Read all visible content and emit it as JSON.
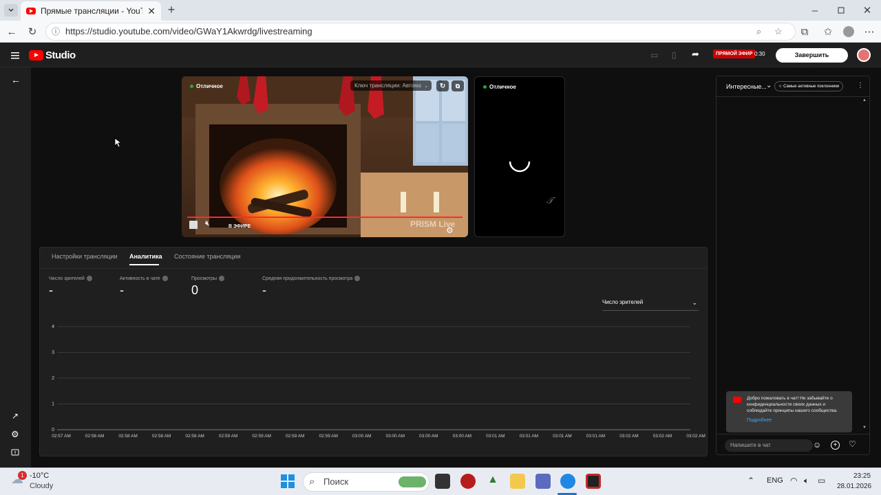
{
  "browser": {
    "tab_title": "Прямые трансляции - YouTube S",
    "url": "https://studio.youtube.com/video/GWaY1Akwrdg/livestreaming"
  },
  "header": {
    "logo_text": "Studio",
    "live_badge": "ПРЯМОЙ ЭФИР",
    "live_time": "0:30",
    "end_button": "Завершить трансляцию"
  },
  "preview": {
    "status": "Отличное",
    "stream_key": "Ключ трансляции: Автома",
    "on_air": "В ЭФИРЕ",
    "watermark": "PRISM Live"
  },
  "vertical_preview": {
    "status": "Отличное"
  },
  "panel": {
    "tabs": [
      {
        "label": "Настройки трансляции",
        "active": false
      },
      {
        "label": "Аналитика",
        "active": true
      },
      {
        "label": "Состояние трансляции",
        "active": false
      }
    ],
    "metrics": [
      {
        "label": "Число зрителей",
        "value": "-"
      },
      {
        "label": "Активность в чате",
        "value": "-"
      },
      {
        "label": "Просмотры",
        "value": "0"
      },
      {
        "label": "Средняя продолжительность просмотра",
        "value": "-"
      }
    ],
    "metric_select": "Число зрителей"
  },
  "chart_data": {
    "type": "line",
    "title": "",
    "ylim": [
      0,
      4
    ],
    "y_ticks": [
      "4",
      "3",
      "2",
      "1",
      "0"
    ],
    "x": [
      "02:57 AM",
      "02:58 AM",
      "02:58 AM",
      "02:58 AM",
      "02:58 AM",
      "02:59 AM",
      "02:59 AM",
      "02:59 AM",
      "02:59 AM",
      "03:00 AM",
      "03:00 AM",
      "03:00 AM",
      "03:00 AM",
      "03:01 AM",
      "03:01 AM",
      "03:01 AM",
      "03:01 AM",
      "03:02 AM",
      "03:02 AM",
      "03:02 AM"
    ],
    "series": [],
    "grid": true
  },
  "chat": {
    "mode": "Интересныe...",
    "top_fans_label": "Самые активные поклонники",
    "welcome_text": "Добро пожаловать в чат! Не забывайте о конфиденциальности своих данных и соблюдайте принципы нашего сообщества.",
    "learn_more": "Подробнее",
    "input_placeholder": "Напишите в чат"
  },
  "taskbar": {
    "weather_temp": "-10°C",
    "weather_desc": "Cloudy",
    "weather_badge": "1",
    "search_placeholder": "Поиск",
    "language": "ENG",
    "time": "23:25",
    "date": "28.01.2026"
  },
  "colors": {
    "accent_red": "#cc0000",
    "live_green": "#2ba640",
    "link_blue": "#3ea6ff"
  }
}
